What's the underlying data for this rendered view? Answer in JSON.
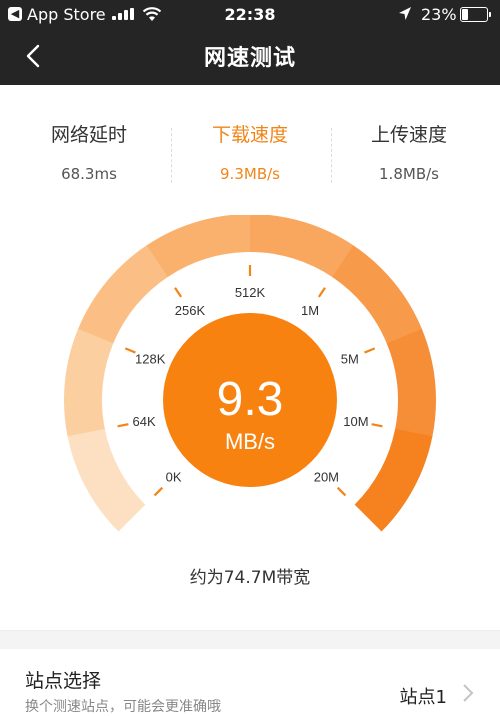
{
  "status_bar": {
    "back_app": "App Store",
    "time": "22:38",
    "battery": "23%",
    "battery_level": 0.23
  },
  "nav": {
    "title": "网速测试"
  },
  "stats": [
    {
      "label": "网络延时",
      "value": "68.3ms"
    },
    {
      "label": "下载速度",
      "value": "9.3MB/s"
    },
    {
      "label": "上传速度",
      "value": "1.8MB/s"
    }
  ],
  "gauge": {
    "value": "9.3",
    "unit": "MB/s",
    "ticks": [
      "0K",
      "64K",
      "128K",
      "256K",
      "512K",
      "1M",
      "5M",
      "10M",
      "20M"
    ],
    "level_segments": 8,
    "colors": {
      "accent": "#f08519",
      "inactive": "#dedede"
    }
  },
  "bandwidth_text": "约为74.7M带宽",
  "site": {
    "title": "站点选择",
    "subtitle": "换个测速站点，可能会更准确哦",
    "value": "站点1"
  }
}
